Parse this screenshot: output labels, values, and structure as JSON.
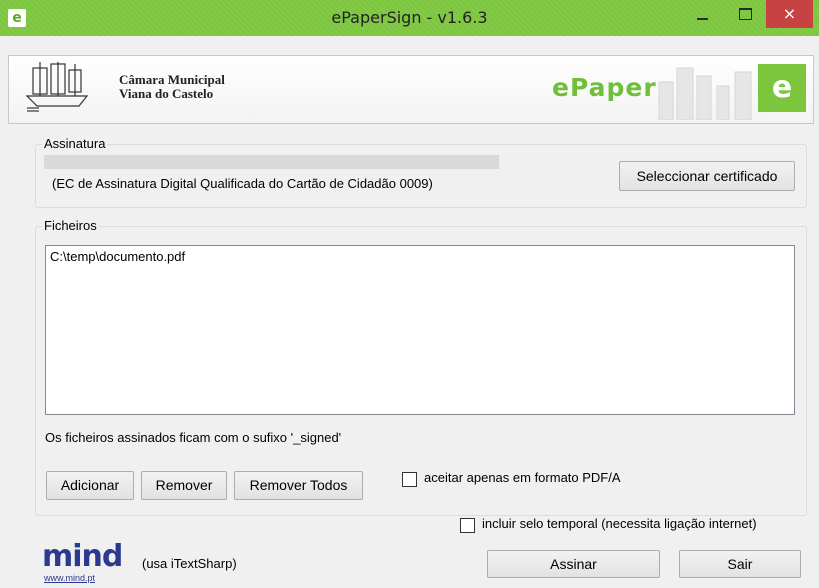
{
  "window": {
    "title": "ePaperSign - v1.6.3",
    "app_icon_letter": "e",
    "controls": {
      "minimize": "minimize-icon",
      "maximize": "maximize-icon",
      "close": "×"
    }
  },
  "header": {
    "org_line1": "Câmara Municipal",
    "org_line2": "Viana do Castelo",
    "brand": "ePaper",
    "brand_tile_letter": "e"
  },
  "signature": {
    "legend": "Assinatura",
    "certificate_description": "(EC de Assinatura Digital Qualificada do Cartão de Cidadão 0009)",
    "select_button": "Seleccionar certificado"
  },
  "files": {
    "legend": "Ficheiros",
    "items": [
      "C:\\temp\\documento.pdf"
    ],
    "suffix_note": "Os ficheiros assinados ficam com o sufixo '_signed'",
    "add_button": "Adicionar",
    "remove_button": "Remover",
    "remove_all_button": "Remover Todos",
    "pdfa_only_label": "aceitar apenas em formato PDF/A",
    "pdfa_only_checked": false
  },
  "timestamp": {
    "label": "incluir selo temporal (necessita ligação internet)",
    "checked": false
  },
  "footer": {
    "logo_text": "mind",
    "logo_url": "www.mind.pt",
    "itext_note": "(usa iTextSharp)",
    "sign_button": "Assinar",
    "exit_button": "Sair"
  },
  "colors": {
    "titlebar": "#7cc63e",
    "close_button": "#c74242",
    "brand_green": "#6fbf3a",
    "mind_blue": "#2b3a8f"
  }
}
